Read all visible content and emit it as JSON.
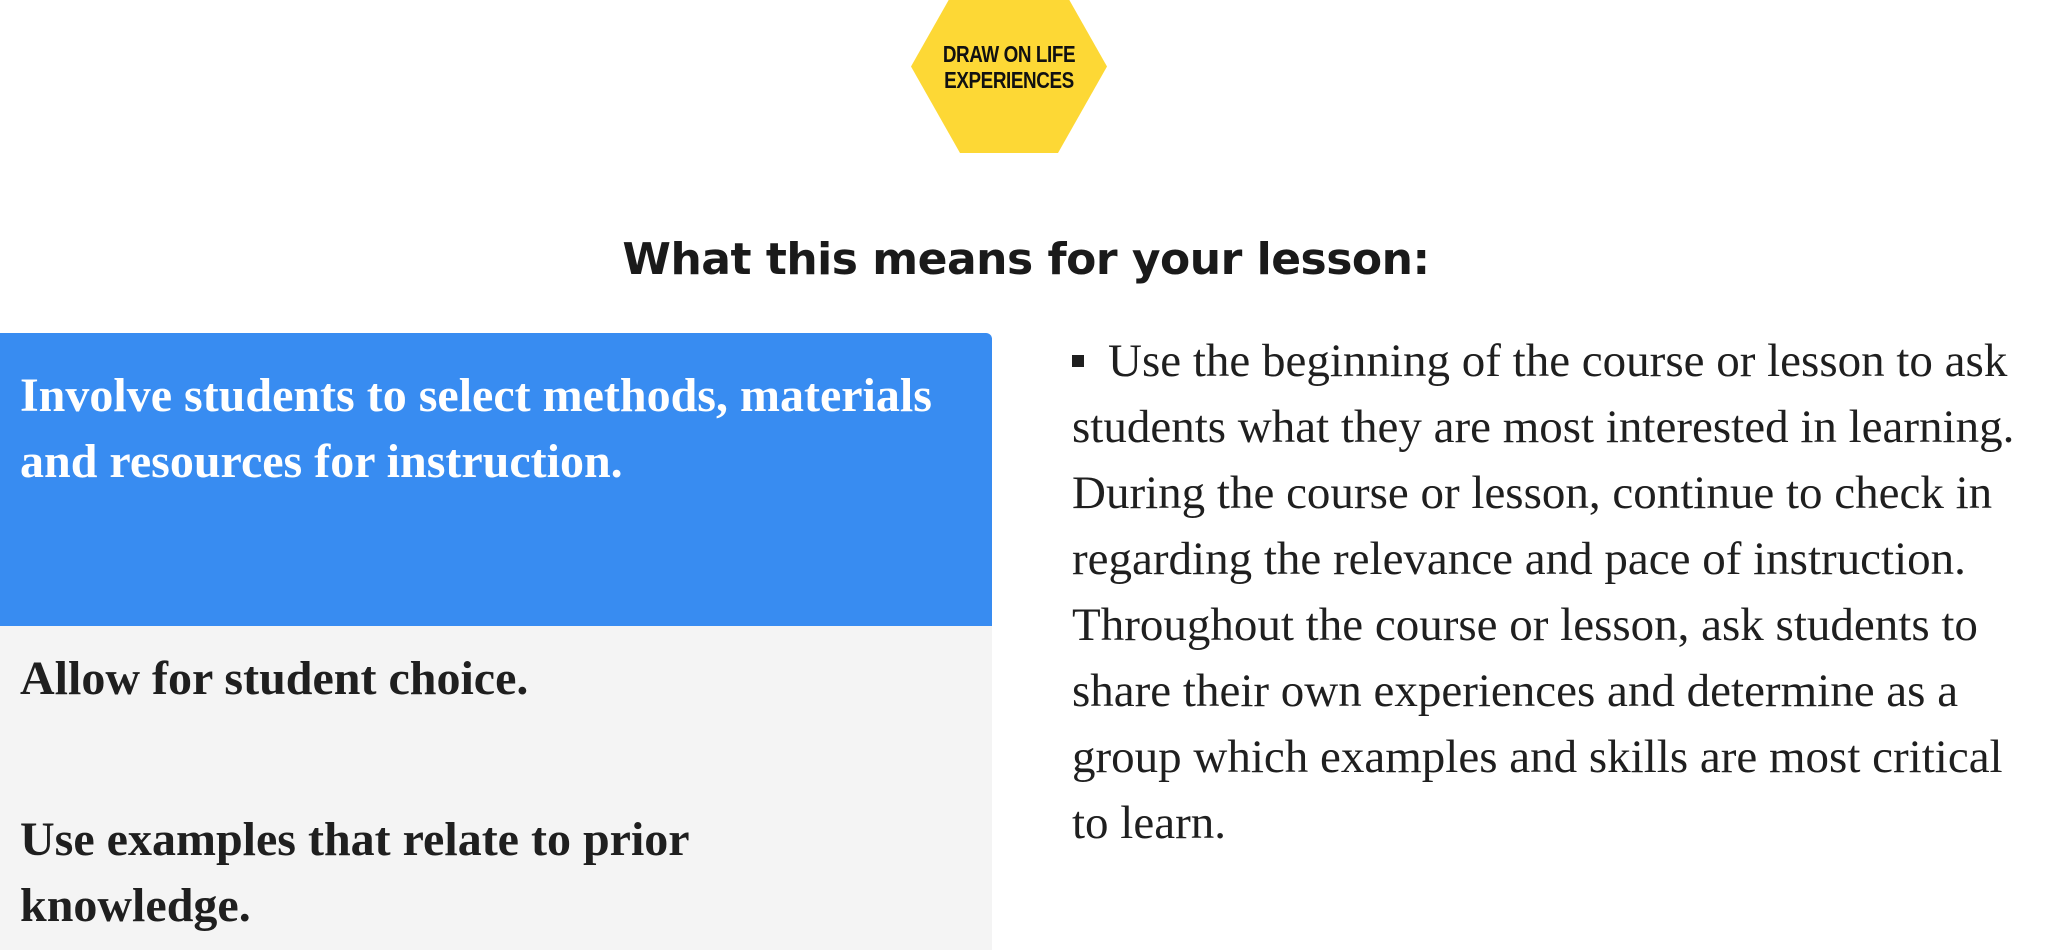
{
  "badge": {
    "line1": "DRAW ON LIFE",
    "line2": "EXPERIENCES",
    "color": "#fdd835"
  },
  "heading": "What this means for your lesson:",
  "tabs": [
    {
      "label": "Involve students to select methods, materials and resources for instruction.",
      "active": true
    },
    {
      "label": "Allow for student choice.",
      "active": false
    },
    {
      "label": "Use examples that relate to prior knowledge.",
      "active": false
    }
  ],
  "content": {
    "bullet_text": "Use the beginning of the course or lesson to ask students what they are most interested in learning. During the course or lesson, continue to check in regarding the relevance and pace of instruction. Throughout the course or lesson, ask students to share their own experiences and determine as a group which examples and skills are most critical to learn."
  },
  "colors": {
    "active_tab": "#388cf1",
    "inactive_tab_bg": "#f4f4f4",
    "text": "#1f1f1f"
  }
}
